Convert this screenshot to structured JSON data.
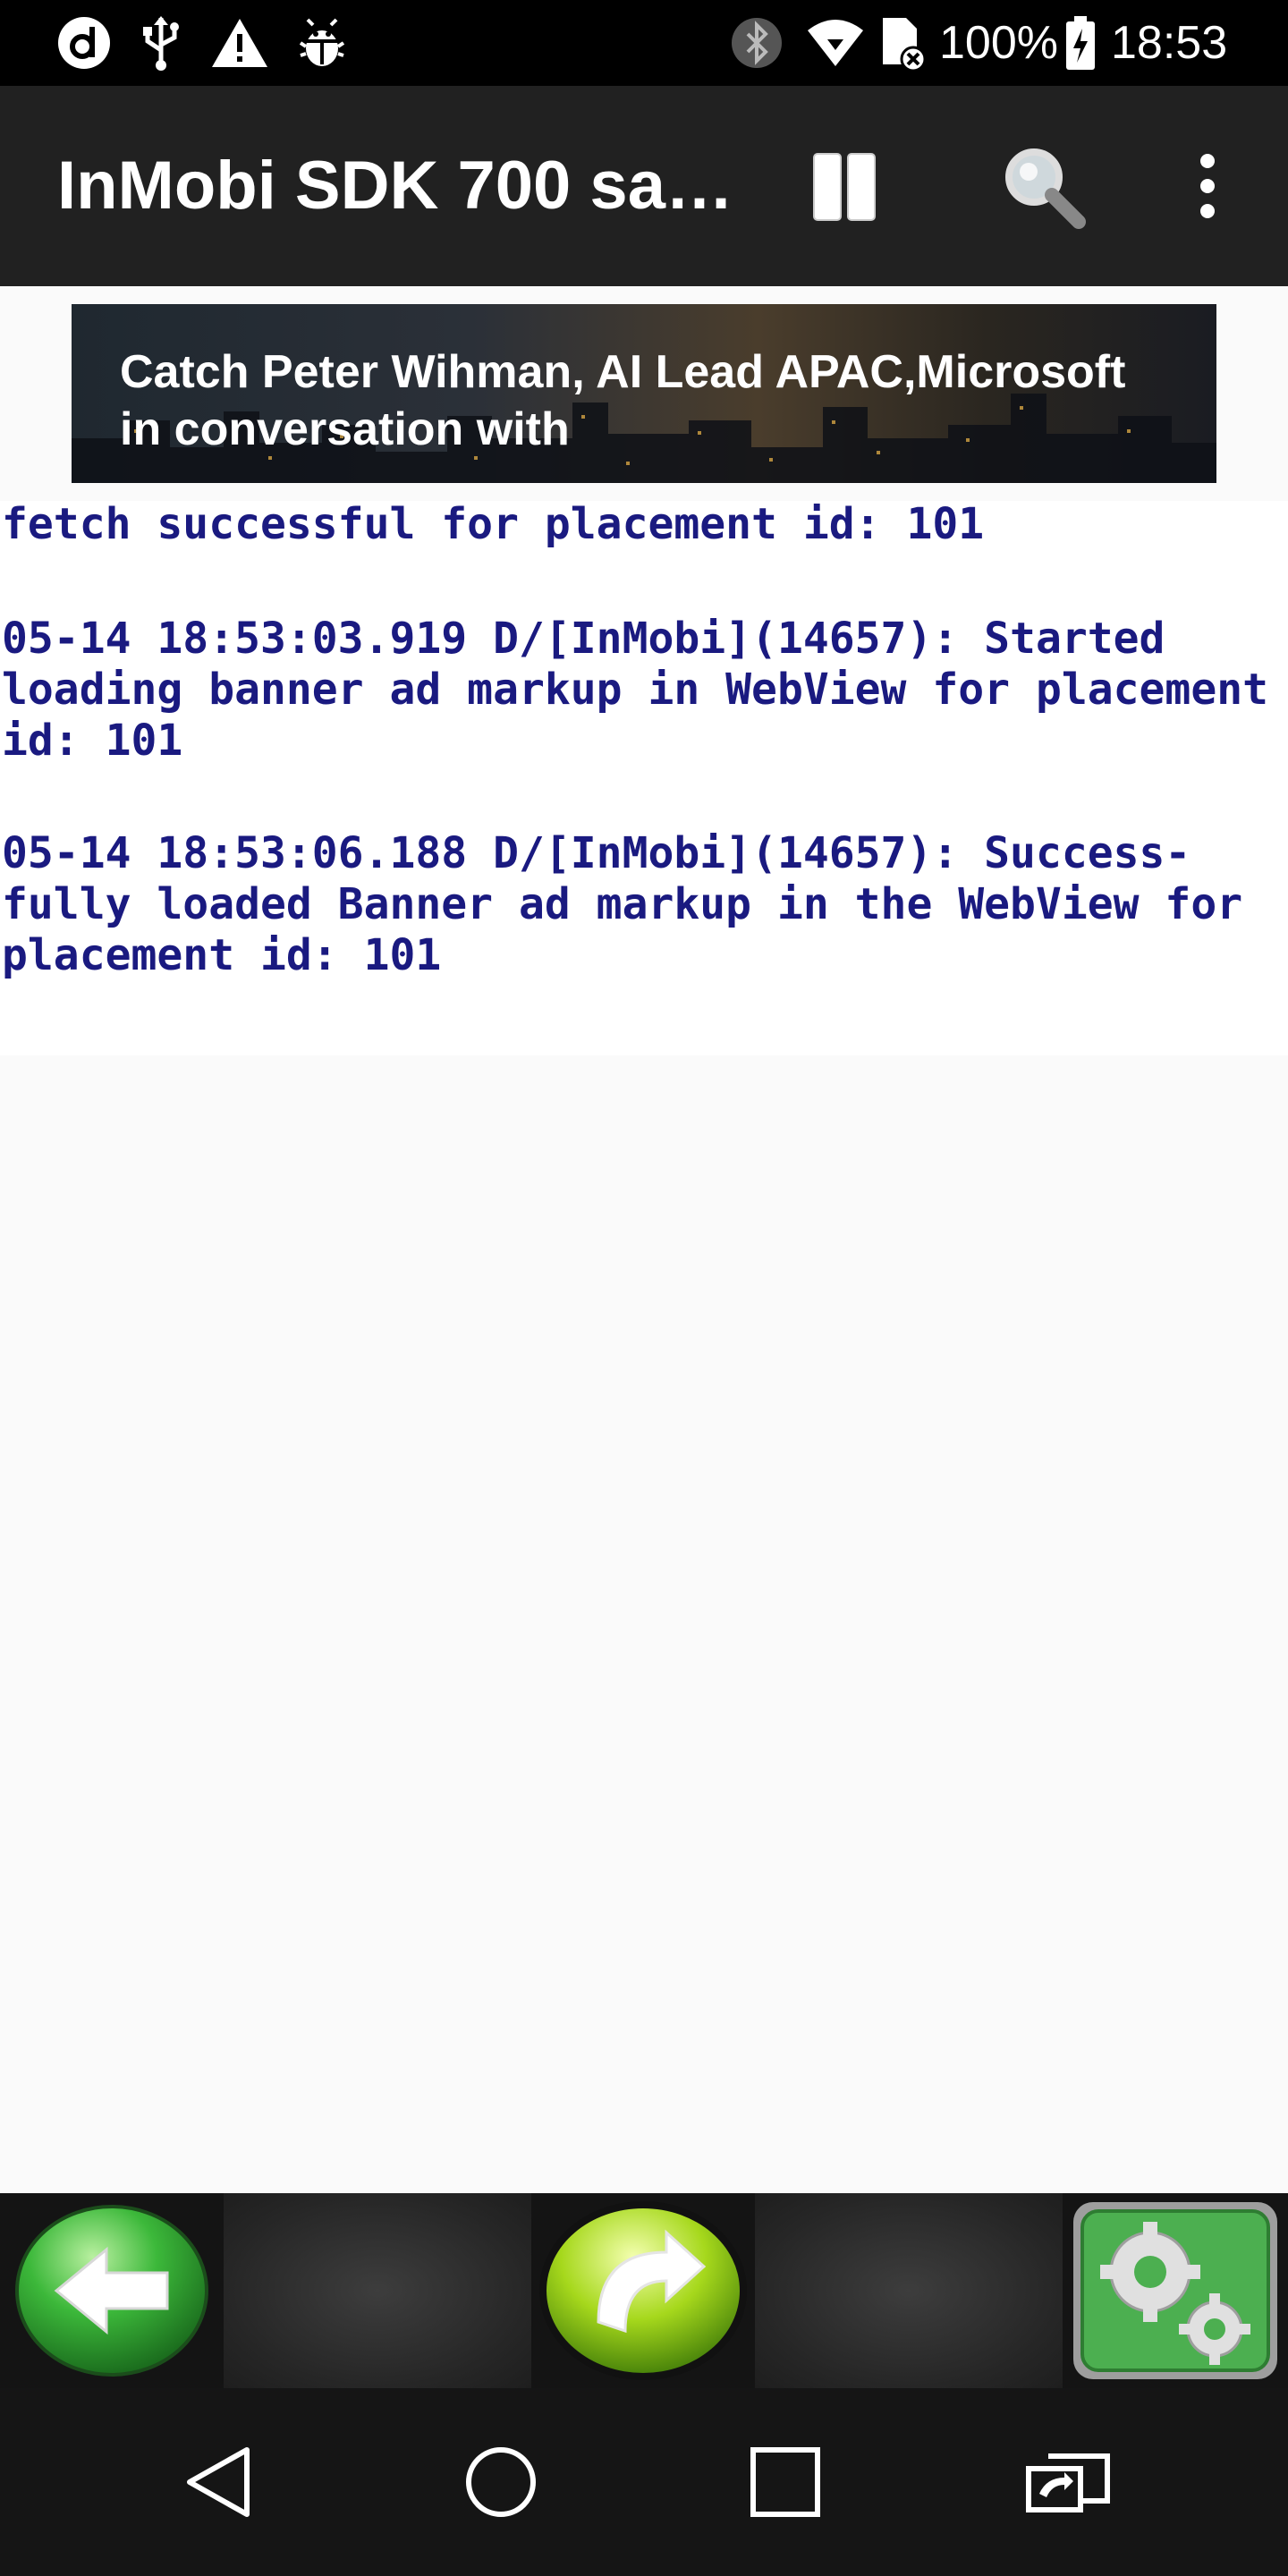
{
  "status_bar": {
    "left_icons": [
      "d-app-icon",
      "usb-icon",
      "warning-icon",
      "android-debug-icon"
    ],
    "right_icons": [
      "bluetooth-icon",
      "wifi-icon",
      "sim-no-service-icon",
      "battery-charging-icon"
    ],
    "battery": "100%",
    "time": "18:53"
  },
  "app_bar": {
    "title": "InMobi SDK 700 sa…",
    "actions": [
      "pause-icon",
      "search-icon",
      "more-vert-icon"
    ]
  },
  "ad_banner": {
    "line1": "Catch Peter Wihman, AI Lead APAC,Microsoft",
    "line2": "in conversation with"
  },
  "log": {
    "entries": [
      "fetch successful for placement id: 101",
      "05-14 18:53:03.919 D/[InMobi](14657): Started loading banner ad markup in WebView for placement id: 101",
      "05-14 18:53:06.188 D/[InMobi](14657): Success-fully loaded Banner ad markup in the WebView for placement id: 101"
    ]
  },
  "toolbar": {
    "buttons": [
      "back-arrow-icon",
      "refresh-icon",
      "settings-gears-icon"
    ]
  },
  "nav_bar": {
    "buttons": [
      "nav-back-icon",
      "nav-home-icon",
      "nav-recents-icon",
      "screen-cast-icon"
    ]
  },
  "colors": {
    "log_text": "#1a1a80",
    "app_bar": "#212121",
    "green_button": "#3cb83a"
  }
}
